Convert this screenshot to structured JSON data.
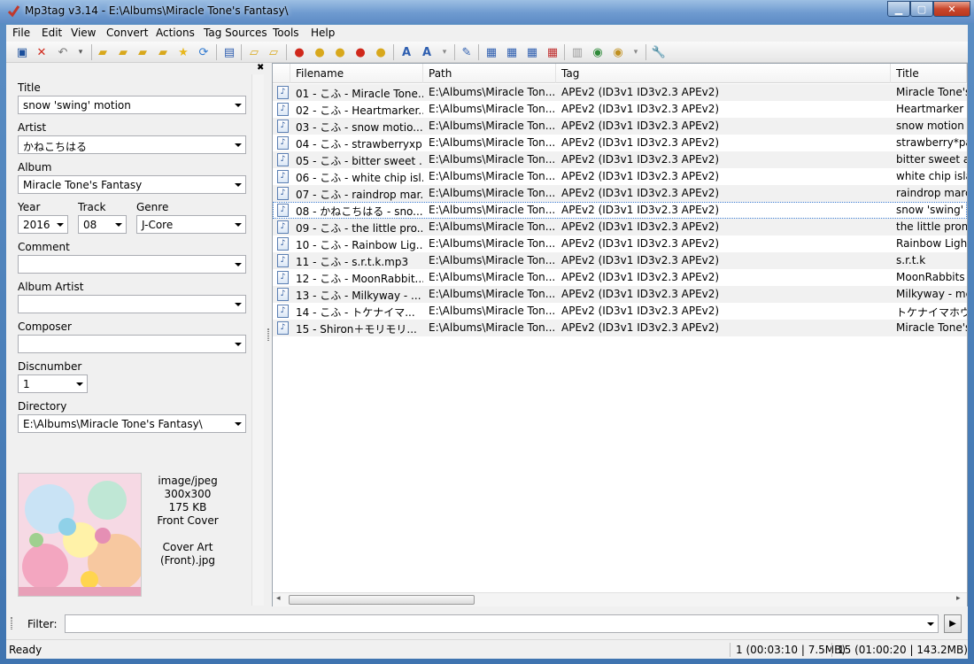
{
  "window": {
    "title": "Mp3tag v3.14  -  E:\\Albums\\Miracle Tone's Fantasy\\"
  },
  "menu": [
    "File",
    "Edit",
    "View",
    "Convert",
    "Actions",
    "Tag Sources",
    "Tools",
    "Help"
  ],
  "toolbar": {
    "icons": [
      "save-icon",
      "remove-tag-icon",
      "undo-icon",
      "dropdown-icon",
      "change-directory-icon",
      "add-directory-icon",
      "favorites-icon",
      "refresh-icon",
      "tag-to-filename-icon",
      "filename-to-tag-icon",
      "text-to-tag-icon",
      "tag-to-tag-icon",
      "export-icon",
      "actions-icon",
      "sources-icon",
      "case-conversion-icon",
      "options-icon"
    ]
  },
  "tagpanel": {
    "title_label": "Title",
    "title_value": "snow 'swing' motion",
    "artist_label": "Artist",
    "artist_value": "かねこちはる",
    "album_label": "Album",
    "album_value": "Miracle Tone's Fantasy",
    "year_label": "Year",
    "year_value": "2016",
    "track_label": "Track",
    "track_value": "08",
    "genre_label": "Genre",
    "genre_value": "J-Core",
    "comment_label": "Comment",
    "comment_value": "",
    "album_artist_label": "Album Artist",
    "album_artist_value": "",
    "composer_label": "Composer",
    "composer_value": "",
    "discnumber_label": "Discnumber",
    "discnumber_value": "1",
    "directory_label": "Directory",
    "directory_value": "E:\\Albums\\Miracle Tone's Fantasy\\",
    "cover": {
      "mime": "image/jpeg",
      "dimensions": "300x300",
      "size": "175 KB",
      "type": "Front Cover",
      "desc1": "Cover Art",
      "desc2": "(Front).jpg"
    }
  },
  "list": {
    "columns": [
      "Filename",
      "Path",
      "Tag",
      "Title"
    ],
    "rows": [
      {
        "filename": "01 - こふ - Miracle Tone...",
        "path": "E:\\Albums\\Miracle Ton...",
        "tag": "APEv2 (ID3v1 ID3v2.3 APEv2)",
        "title": "Miracle Tone's"
      },
      {
        "filename": "02 - こふ - Heartmarker....",
        "path": "E:\\Albums\\Miracle Ton...",
        "tag": "APEv2 (ID3v1 ID3v2.3 APEv2)",
        "title": "Heartmarker"
      },
      {
        "filename": "03 - こふ - snow motio...",
        "path": "E:\\Albums\\Miracle Ton...",
        "tag": "APEv2 (ID3v1 ID3v2.3 APEv2)",
        "title": "snow motion (l"
      },
      {
        "filename": "04 - こふ - strawberryxp...",
        "path": "E:\\Albums\\Miracle Ton...",
        "tag": "APEv2 (ID3v1 ID3v2.3 APEv2)",
        "title": "strawberry*pas"
      },
      {
        "filename": "05 - こふ - bitter sweet ...",
        "path": "E:\\Albums\\Miracle Ton...",
        "tag": "APEv2 (ID3v1 ID3v2.3 APEv2)",
        "title": "bitter sweet ave"
      },
      {
        "filename": "06 - こふ - white chip isl...",
        "path": "E:\\Albums\\Miracle Ton...",
        "tag": "APEv2 (ID3v1 ID3v2.3 APEv2)",
        "title": "white chip islar"
      },
      {
        "filename": "07 - こふ - raindrop mar...",
        "path": "E:\\Albums\\Miracle Ton...",
        "tag": "APEv2 (ID3v1 ID3v2.3 APEv2)",
        "title": "raindrop march"
      },
      {
        "filename": "08 - かねこちはる - sno...",
        "path": "E:\\Albums\\Miracle Ton...",
        "tag": "APEv2 (ID3v1 ID3v2.3 APEv2)",
        "title": "snow 'swing' m"
      },
      {
        "filename": "09 - こふ - the little pro...",
        "path": "E:\\Albums\\Miracle Ton...",
        "tag": "APEv2 (ID3v1 ID3v2.3 APEv2)",
        "title": "the little promis"
      },
      {
        "filename": "10 - こふ - Rainbow Lig...",
        "path": "E:\\Albums\\Miracle Ton...",
        "tag": "APEv2 (ID3v1 ID3v2.3 APEv2)",
        "title": "Rainbow Light"
      },
      {
        "filename": "11 - こふ - s.r.t.k.mp3",
        "path": "E:\\Albums\\Miracle Ton...",
        "tag": "APEv2 (ID3v1 ID3v2.3 APEv2)",
        "title": "s.r.t.k"
      },
      {
        "filename": "12 - こふ - MoonRabbit...",
        "path": "E:\\Albums\\Miracle Ton...",
        "tag": "APEv2 (ID3v1 ID3v2.3 APEv2)",
        "title": "MoonRabbits"
      },
      {
        "filename": "13 - こふ - Milkyway - ...",
        "path": "E:\\Albums\\Miracle Ton...",
        "tag": "APEv2 (ID3v1 ID3v2.3 APEv2)",
        "title": "Milkyway - mel"
      },
      {
        "filename": "14 - こふ - トケナイマ...",
        "path": "E:\\Albums\\Miracle Ton...",
        "tag": "APEv2 (ID3v1 ID3v2.3 APEv2)",
        "title": "トケナイマホウ"
      },
      {
        "filename": "15 - Shiron＋モリモリ...",
        "path": "E:\\Albums\\Miracle Ton...",
        "tag": "APEv2 (ID3v1 ID3v2.3 APEv2)",
        "title": "Miracle Tone's"
      }
    ],
    "selected_index": 7
  },
  "filter": {
    "label": "Filter:",
    "value": ""
  },
  "status": {
    "left": "Ready",
    "selected": "1 (00:03:10 | 7.5MB)",
    "total": "15 (01:00:20 | 143.2MB)"
  },
  "colors": {
    "titlebar": "#6f9bd0",
    "selection_outline": "#3b7bd0",
    "alt_row": "#f1f1f1"
  }
}
